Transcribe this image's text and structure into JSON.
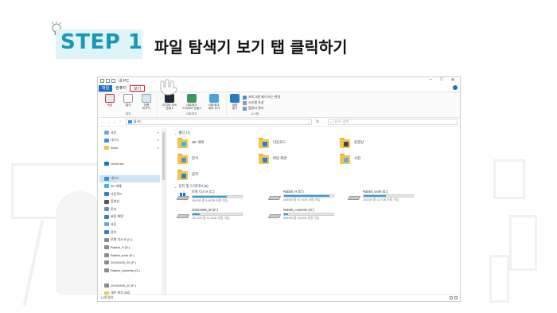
{
  "header": {
    "step": "STEP 1",
    "title": "파일 탐색기 보기 탭 클릭하기"
  },
  "window": {
    "title": "내 PC",
    "controls": [
      "–",
      "□",
      "✕"
    ],
    "ribbon_tabs": [
      {
        "label": "파일"
      },
      {
        "label": "컴퓨터"
      },
      {
        "label": "보기"
      }
    ],
    "ribbon": {
      "location": {
        "buttons": [
          "속성",
          "열기",
          "이름\n바꾸기"
        ],
        "name": "위치"
      },
      "network": {
        "buttons": [
          "미디어 서버\n연결 ▾",
          "네트워크\n드라이브 연결 ▾",
          "네트워크\n위치 추가"
        ],
        "name": "네트워크"
      },
      "system": {
        "button": "설정\n열기",
        "items": [
          "프로그램 제거 또는 변경",
          "시스템 속성",
          "컴퓨터 관리"
        ],
        "name": "시스템"
      }
    },
    "address": {
      "path": "내 PC",
      "search_placeholder": "내 PC 검색"
    },
    "nav": [
      {
        "label": "사진",
        "pinned": true,
        "color": "#6aa9e0"
      },
      {
        "label": "내 PC",
        "pinned": true,
        "color": "#3a8ee6"
      },
      {
        "label": "Work",
        "pinned": true,
        "color": "#f3c54e"
      },
      {
        "label": "",
        "pinned": false,
        "color": "transparent"
      },
      {
        "label": "OneDrive",
        "pinned": false,
        "color": "#1f72c8"
      },
      {
        "label": "",
        "pinned": false,
        "color": "transparent"
      },
      {
        "label": "내 PC",
        "pinned": false,
        "color": "#3a8ee6",
        "selected": true
      },
      {
        "label": "3D 개체",
        "pinned": false,
        "color": "#3fb6e8"
      },
      {
        "label": "다운로드",
        "pinned": false,
        "color": "#2f7fd1"
      },
      {
        "label": "동영상",
        "pinned": false,
        "color": "#555555"
      },
      {
        "label": "문서",
        "pinned": false,
        "color": "#6b8cb7"
      },
      {
        "label": "바탕 화면",
        "pinned": false,
        "color": "#2f7fd1"
      },
      {
        "label": "사진",
        "pinned": false,
        "color": "#6aa9e0"
      },
      {
        "label": "음악",
        "pinned": false,
        "color": "#2f7fd1"
      },
      {
        "label": "로컬 디스크 (C:)",
        "pinned": false,
        "color": "#8a8a8a"
      },
      {
        "label": "Rabbit_H (D:)",
        "pinned": false,
        "color": "#8a8a8a"
      },
      {
        "label": "Rabbit_work (E:)",
        "pinned": false,
        "color": "#8a8a8a"
      },
      {
        "label": "20151009_20 (F:)",
        "pinned": false,
        "color": "#8a8a8a"
      },
      {
        "label": "Rabbit_contents (G:)",
        "pinned": false,
        "color": "#8a8a8a"
      },
      {
        "label": "",
        "pinned": false,
        "color": "transparent"
      },
      {
        "label": "20151009_20 (F:)",
        "pinned": false,
        "color": "#8a8a8a"
      },
      {
        "label": "개인 백업 자료",
        "pinned": false,
        "color": "#f3c54e"
      },
      {
        "label": "",
        "pinned": false,
        "color": "transparent"
      },
      {
        "label": "Rabbit_contents (G:)",
        "pinned": false,
        "color": "#8a8a8a"
      },
      {
        "label": "",
        "pinned": false,
        "color": "transparent"
      },
      {
        "label": "Rabbit_work (E:)",
        "pinned": false,
        "color": "#8a8a8a"
      }
    ],
    "folders_header": "폴더 (7)",
    "folders": [
      {
        "name": "3D 개체",
        "emblem": "#3fb6e8"
      },
      {
        "name": "다운로드",
        "emblem": "#2f7fd1"
      },
      {
        "name": "동영상",
        "emblem": "#444444"
      },
      {
        "name": "문서",
        "emblem": "#6b8cb7"
      },
      {
        "name": "바탕 화면",
        "emblem": "#2f7fd1"
      },
      {
        "name": "사진",
        "emblem": "#6aa9e0"
      },
      {
        "name": "음악",
        "emblem": "#2f7fd1"
      }
    ],
    "drives_header": "장치 및 드라이브 (5)",
    "drives": [
      {
        "name": "로컬 디스크 (C:)",
        "free": "464GB 중 146GB 사용 가능",
        "used_fraction": 0.69,
        "system": true
      },
      {
        "name": "Rabbit_H (D:)",
        "free": "465GB 중 37.4GB 사용 가능",
        "used_fraction": 0.92,
        "system": false
      },
      {
        "name": "Rabbit_work (E:)",
        "free": "232GB 중 127GB 사용 가능",
        "used_fraction": 0.45,
        "system": false
      },
      {
        "name": "20151009_20 (F:)",
        "free": "15.1GB 중 13.0GB 사용 가능",
        "used_fraction": 0.14,
        "system": false
      },
      {
        "name": "Rabbit_contents (G:)",
        "free": "465GB 중 430GB 사용 가능",
        "used_fraction": 0.08,
        "system": false
      }
    ],
    "status": "12개 항목"
  },
  "colors": {
    "accent": "#1898b8",
    "accent_bg": "#dff4f7",
    "file_tab": "#1a6fc4",
    "highlight": "#e0201b",
    "drive_bar": "#26a0da"
  }
}
